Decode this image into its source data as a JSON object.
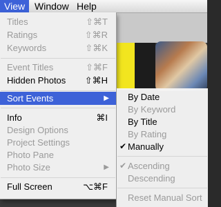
{
  "menubar": {
    "view": "View",
    "window": "Window",
    "help": "Help"
  },
  "view_menu": {
    "titles": {
      "label": "Titles",
      "shortcut": "⇧⌘T"
    },
    "ratings": {
      "label": "Ratings",
      "shortcut": "⇧⌘R"
    },
    "keywords": {
      "label": "Keywords",
      "shortcut": "⇧⌘K"
    },
    "event_titles": {
      "label": "Event Titles",
      "shortcut": "⇧⌘F"
    },
    "hidden_photos": {
      "label": "Hidden Photos",
      "shortcut": "⇧⌘H"
    },
    "sort_events": {
      "label": "Sort Events"
    },
    "info": {
      "label": "Info",
      "shortcut": "⌘I"
    },
    "design_options": {
      "label": "Design Options"
    },
    "project_settings": {
      "label": "Project Settings"
    },
    "photo_pane": {
      "label": "Photo Pane"
    },
    "photo_size": {
      "label": "Photo Size"
    },
    "full_screen": {
      "label": "Full Screen",
      "shortcut": "⌥⌘F"
    }
  },
  "sort_menu": {
    "by_date": "By Date",
    "by_keyword": "By Keyword",
    "by_title": "By Title",
    "by_rating": "By Rating",
    "manually": "Manually",
    "ascending": "Ascending",
    "descending": "Descending",
    "reset_manual_sort": "Reset Manual Sort"
  },
  "icons": {
    "submenu_arrow": "▶",
    "checkmark": "✔"
  }
}
